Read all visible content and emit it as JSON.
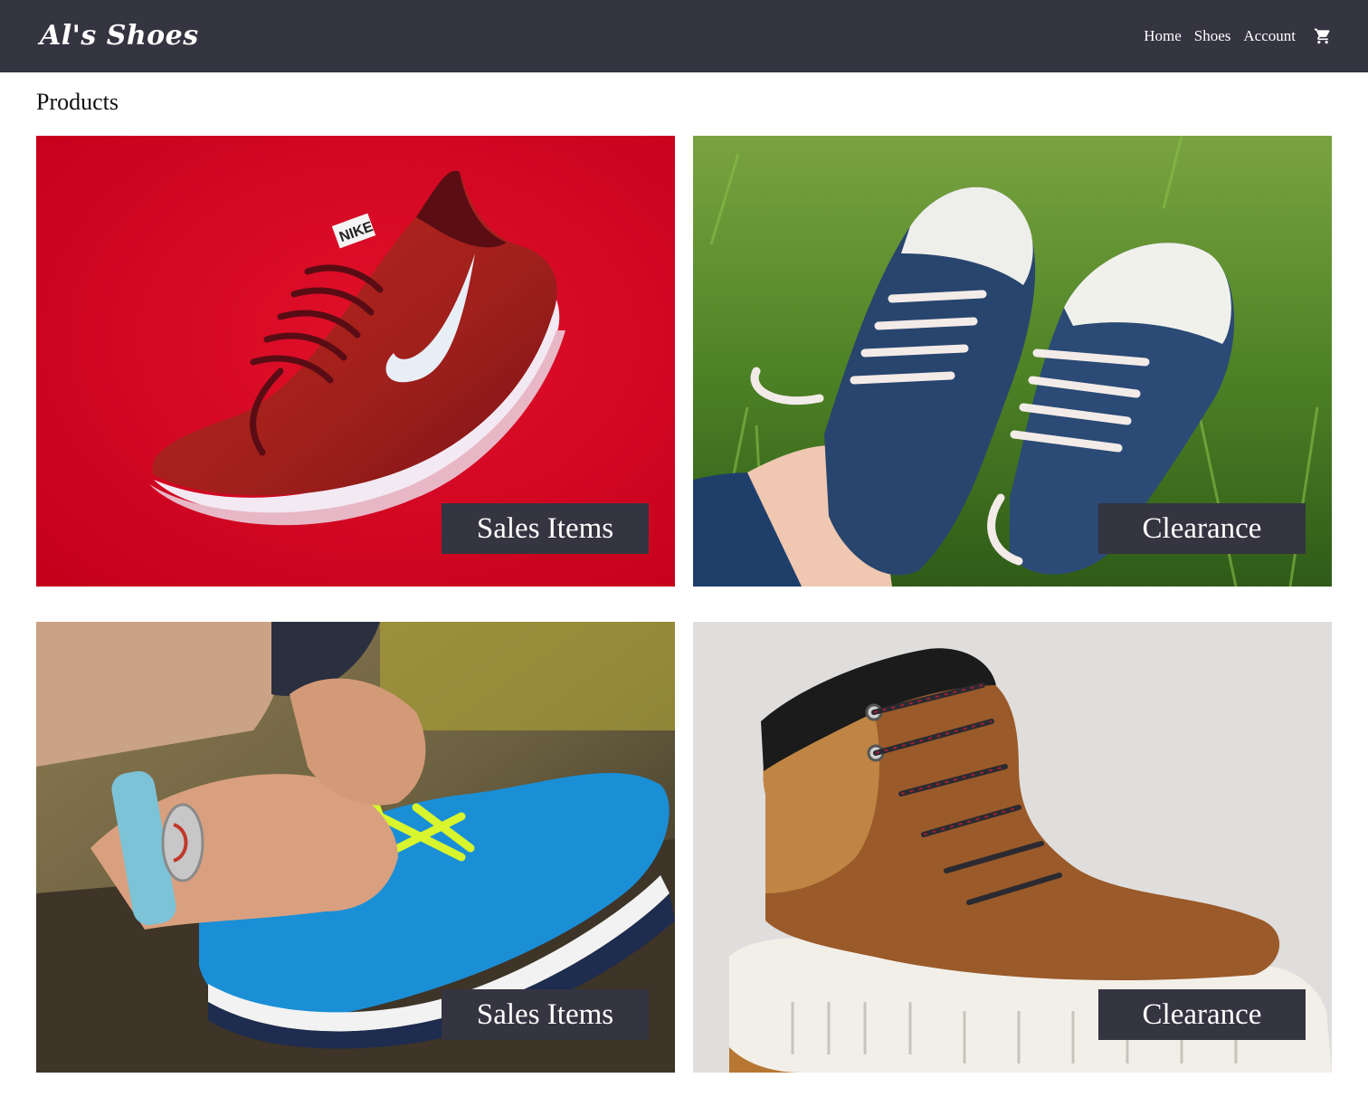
{
  "header": {
    "logo": "Al's Shoes",
    "nav": [
      "Home",
      "Shoes",
      "Account"
    ],
    "cart_icon": "shopping-cart-icon",
    "background": "#353441"
  },
  "main": {
    "title": "Products",
    "tiles": [
      {
        "label": "Sales Items",
        "image": "red-running-sneaker"
      },
      {
        "label": "Clearance",
        "image": "blue-canvas-sneakers-on-grass"
      },
      {
        "label": "Sales Items",
        "image": "hands-tying-blue-sneaker"
      },
      {
        "label": "Clearance",
        "image": "brown-leather-boot"
      }
    ]
  }
}
